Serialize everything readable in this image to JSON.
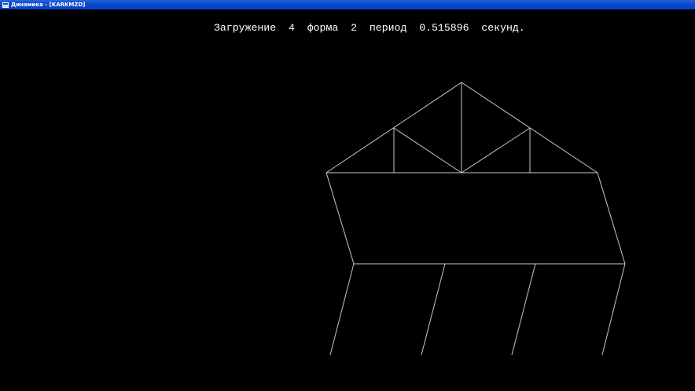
{
  "window": {
    "title": "Динамика - [KARKMZD]"
  },
  "header": {
    "load_label": "Загружение",
    "load_number": "4",
    "mode_label": "форма",
    "mode_number": "2",
    "period_label": "период",
    "period_value": "0.515896",
    "unit": "секунд."
  },
  "colors": {
    "background": "#000000",
    "text": "#ffffff",
    "lines": "#c8c8c8",
    "titlebar": "#0a4ad0"
  }
}
